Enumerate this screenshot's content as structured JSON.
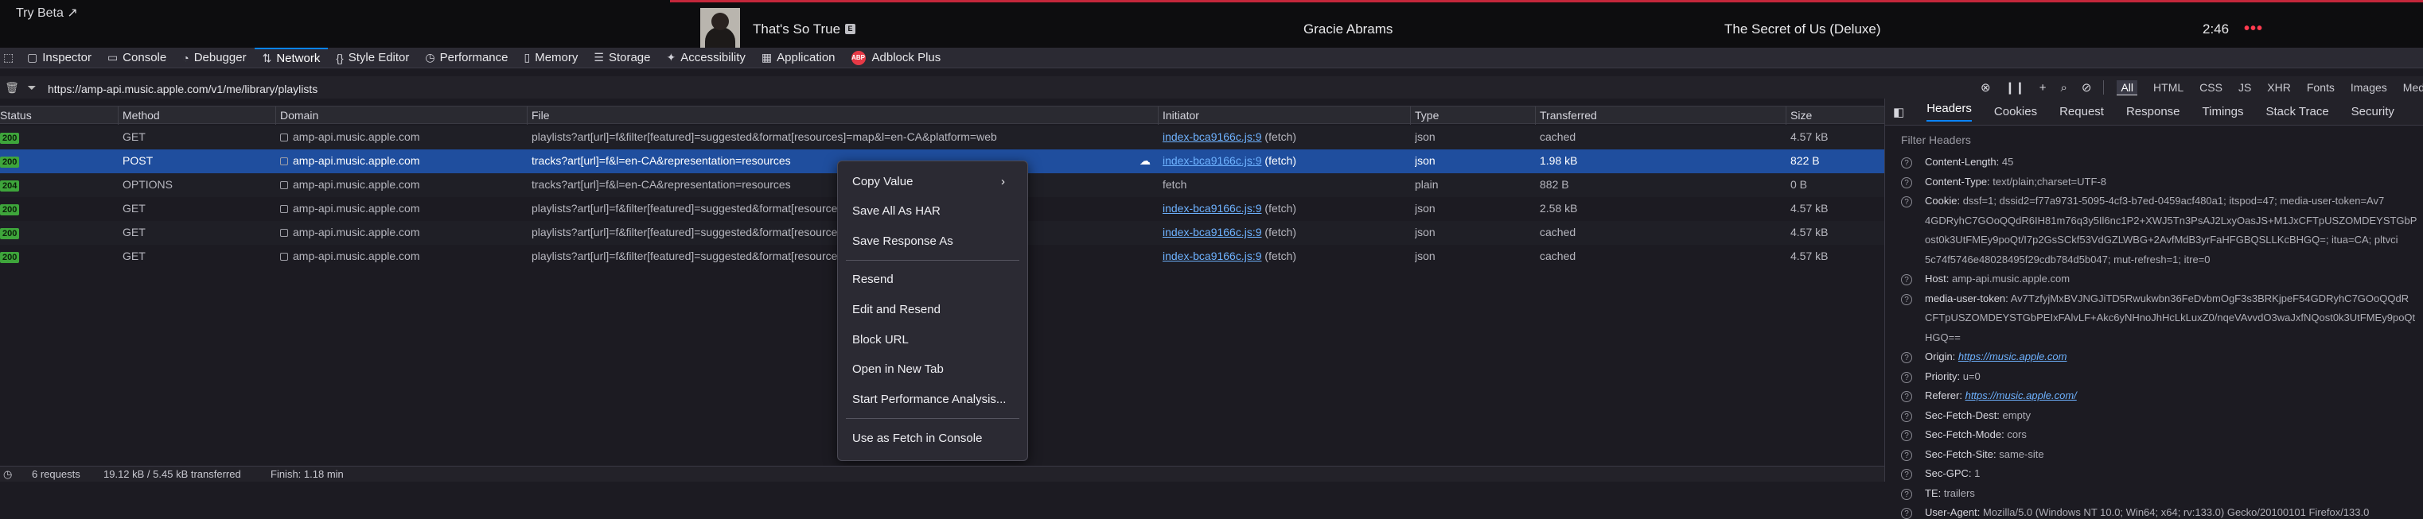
{
  "player": {
    "try_beta": "Try Beta ↗",
    "track_title": "That's So True",
    "explicit_badge": "E",
    "artist": "Gracie Abrams",
    "album": "The Secret of Us (Deluxe)",
    "time": "2:46",
    "more_label": "•••"
  },
  "devtools_tabs": [
    {
      "label": "Inspector",
      "icon": "inspector-icon"
    },
    {
      "label": "Console",
      "icon": "console-icon"
    },
    {
      "label": "Debugger",
      "icon": "debugger-icon"
    },
    {
      "label": "Network",
      "icon": "network-icon",
      "active": true
    },
    {
      "label": "Style Editor",
      "icon": "style-editor-icon"
    },
    {
      "label": "Performance",
      "icon": "performance-icon"
    },
    {
      "label": "Memory",
      "icon": "memory-icon"
    },
    {
      "label": "Storage",
      "icon": "storage-icon"
    },
    {
      "label": "Accessibility",
      "icon": "accessibility-icon"
    },
    {
      "label": "Application",
      "icon": "application-icon"
    },
    {
      "label": "Adblock Plus",
      "icon": "adblock-icon",
      "badge": "ABP"
    }
  ],
  "filter": {
    "url": "https://amp-api.music.apple.com/v1/me/library/playlists",
    "types": [
      "All",
      "HTML",
      "CSS",
      "JS",
      "XHR",
      "Fonts",
      "Images",
      "Media"
    ]
  },
  "table": {
    "columns": [
      "Status",
      "Method",
      "Domain",
      "File",
      "Initiator",
      "Type",
      "Transferred",
      "Size"
    ],
    "rows": [
      {
        "status": "200",
        "method": "GET",
        "domain": "amp-api.music.apple.com",
        "file": "playlists?art[url]=f&filter[featured]=suggested&format[resources]=map&l=en-CA&platform=web",
        "initiator": "index-bca9166c.js:9",
        "initiator_suffix": " (fetch)",
        "type": "json",
        "transferred": "cached",
        "size": "4.57 kB"
      },
      {
        "status": "200",
        "method": "POST",
        "domain": "amp-api.music.apple.com",
        "file": "tracks?art[url]=f&l=en-CA&representation=resources",
        "initiator": "index-bca9166c.js:9",
        "initiator_suffix": " (fetch)",
        "type": "json",
        "transferred": "1.98 kB",
        "size": "822 B",
        "selected": true
      },
      {
        "status": "204",
        "method": "OPTIONS",
        "domain": "amp-api.music.apple.com",
        "file": "tracks?art[url]=f&l=en-CA&representation=resources",
        "initiator": "",
        "initiator_plain": "fetch",
        "initiator_suffix": "",
        "type": "plain",
        "transferred": "882 B",
        "size": "0 B"
      },
      {
        "status": "200",
        "method": "GET",
        "domain": "amp-api.music.apple.com",
        "file": "playlists?art[url]=f&filter[featured]=suggested&format[resources]",
        "initiator": "index-bca9166c.js:9",
        "initiator_suffix": " (fetch)",
        "type": "json",
        "transferred": "2.58 kB",
        "size": "4.57 kB"
      },
      {
        "status": "200",
        "method": "GET",
        "domain": "amp-api.music.apple.com",
        "file": "playlists?art[url]=f&filter[featured]=suggested&format[resources]",
        "initiator": "index-bca9166c.js:9",
        "initiator_suffix": " (fetch)",
        "type": "json",
        "transferred": "cached",
        "size": "4.57 kB"
      },
      {
        "status": "200",
        "method": "GET",
        "domain": "amp-api.music.apple.com",
        "file": "playlists?art[url]=f&filter[featured]=suggested&format[resources]",
        "initiator": "index-bca9166c.js:9",
        "initiator_suffix": " (fetch)",
        "type": "json",
        "transferred": "cached",
        "size": "4.57 kB"
      }
    ]
  },
  "context_menu": {
    "items": [
      {
        "label": "Copy Value",
        "submenu": true
      },
      {
        "label": "Save All As HAR"
      },
      {
        "label": "Save Response As"
      },
      {
        "label": "Resend"
      },
      {
        "label": "Edit and Resend"
      },
      {
        "label": "Block URL"
      },
      {
        "label": "Open in New Tab"
      },
      {
        "label": "Start Performance Analysis..."
      },
      {
        "label": "Use as Fetch in Console"
      }
    ]
  },
  "side_panel": {
    "tabs": [
      "Headers",
      "Cookies",
      "Request",
      "Response",
      "Timings",
      "Stack Trace",
      "Security"
    ],
    "filter_placeholder": "Filter Headers",
    "headers": [
      {
        "key": "Content-Length:",
        "value": "45"
      },
      {
        "key": "Content-Type:",
        "value": "text/plain;charset=UTF-8"
      },
      {
        "key": "Cookie:",
        "value": "dssf=1; dssid2=f77a9731-5095-4cf3-b7ed-0459acf480a1; itspod=47; media-user-token=Av7"
      },
      {
        "key": "",
        "value": "4GDRyhC7GOoQQdR6IH81m76q3y5Il6nc1P2+XWJ5Tn3PsAJ2LxyOasJS+M1JxCFTpUSZOMDEYSTGbP"
      },
      {
        "key": "",
        "value": "ost0k3UtFMEy9poQt/I7p2GsSCkf53VdGZLWBG+2AvfMdB3yrFaHFGBQSLLKcBHGQ=; itua=CA; pltvci"
      },
      {
        "key": "",
        "value": "5c74f5746e48028495f29cdb784d5b047; mut-refresh=1; itre=0"
      },
      {
        "key": "Host:",
        "value": "amp-api.music.apple.com"
      },
      {
        "key": "media-user-token:",
        "value": "Av7TzfyjMxBVJNGJiTD5Rwukwbn36FeDvbmOgF3s3BRKjpeF54GDRyhC7GOoQQdR"
      },
      {
        "key": "",
        "value": "CFTpUSZOMDEYSTGbPEIxFAlvLF+Akc6yNHnoJhHcLkLuxZ0/nqeVAvvdO3waJxfNQost0k3UtFMEy9poQt"
      },
      {
        "key": "",
        "value": "HGQ=="
      },
      {
        "key": "Origin:",
        "value": "https://music.apple.com",
        "link": true
      },
      {
        "key": "Priority:",
        "value": "u=0"
      },
      {
        "key": "Referer:",
        "value": "https://music.apple.com/",
        "link": true
      },
      {
        "key": "Sec-Fetch-Dest:",
        "value": "empty"
      },
      {
        "key": "Sec-Fetch-Mode:",
        "value": "cors"
      },
      {
        "key": "Sec-Fetch-Site:",
        "value": "same-site"
      },
      {
        "key": "Sec-GPC:",
        "value": "1"
      },
      {
        "key": "TE:",
        "value": "trailers"
      },
      {
        "key": "User-Agent:",
        "value": "Mozilla/5.0 (Windows NT 10.0; Win64; x64; rv:133.0) Gecko/20100101 Firefox/133.0"
      }
    ]
  },
  "footer": {
    "requests": "6 requests",
    "transferred": "19.12 kB / 5.45 kB transferred",
    "finish": "Finish: 1.18 min"
  },
  "colors": {
    "accent": "#0a84ff",
    "selected_row": "#1f4e9e",
    "status_ok": "#3ea53b",
    "now_playing_bar": "#c4273b"
  }
}
